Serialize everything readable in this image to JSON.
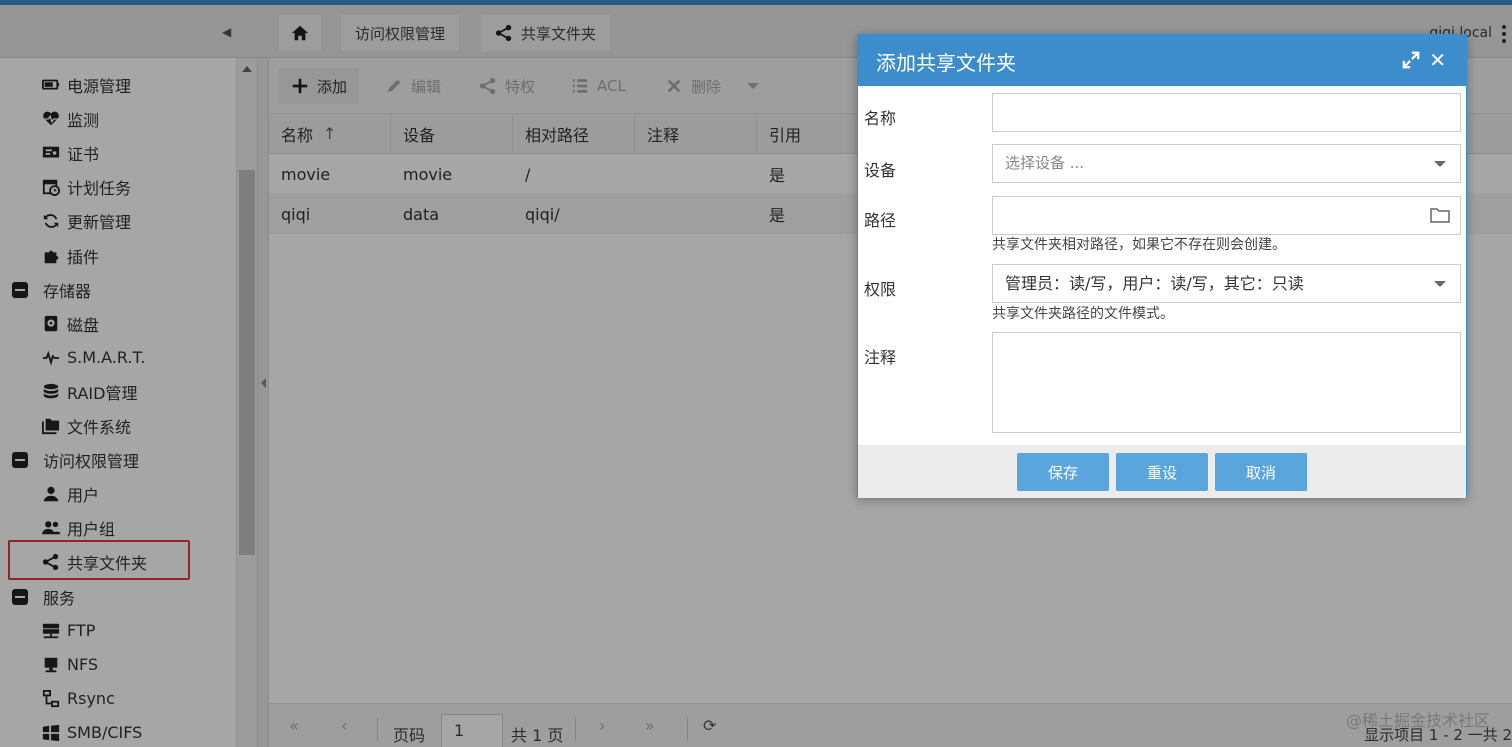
{
  "header": {
    "hostname": "qiqi.local",
    "breadcrumbs": [
      "访问权限管理",
      "共享文件夹"
    ]
  },
  "sidebar": {
    "items": [
      {
        "label": "电源管理",
        "icon": "power-icon"
      },
      {
        "label": "监测",
        "icon": "heartbeat-icon"
      },
      {
        "label": "证书",
        "icon": "certificate-icon"
      },
      {
        "label": "计划任务",
        "icon": "calendar-clock-icon"
      },
      {
        "label": "更新管理",
        "icon": "refresh-icon"
      },
      {
        "label": "插件",
        "icon": "puzzle-icon"
      },
      {
        "label": "存储器",
        "group": true
      },
      {
        "label": "磁盘",
        "icon": "disk-icon"
      },
      {
        "label": "S.M.A.R.T.",
        "icon": "pulse-icon"
      },
      {
        "label": "RAID管理",
        "icon": "database-icon"
      },
      {
        "label": "文件系统",
        "icon": "folders-icon"
      },
      {
        "label": "访问权限管理",
        "group": true
      },
      {
        "label": "用户",
        "icon": "user-icon"
      },
      {
        "label": "用户组",
        "icon": "users-icon"
      },
      {
        "label": "共享文件夹",
        "icon": "share-icon",
        "selected": true
      },
      {
        "label": "服务",
        "group": true
      },
      {
        "label": "FTP",
        "icon": "server-icon"
      },
      {
        "label": "NFS",
        "icon": "monitor-icon"
      },
      {
        "label": "Rsync",
        "icon": "sitemap-icon"
      },
      {
        "label": "SMB/CIFS",
        "icon": "windows-icon"
      }
    ]
  },
  "toolbar": {
    "add": "添加",
    "edit": "编辑",
    "privileges": "特权",
    "acl": "ACL",
    "delete": "删除"
  },
  "grid": {
    "columns": [
      "名称",
      "设备",
      "相对路径",
      "注释",
      "引用"
    ],
    "sort_indicator": "↑",
    "rows": [
      {
        "name": "movie",
        "device": "movie",
        "path": "/",
        "comment": "",
        "referenced": "是"
      },
      {
        "name": "qiqi",
        "device": "data",
        "path": "qiqi/",
        "comment": "",
        "referenced": "是"
      }
    ]
  },
  "pager": {
    "page_label": "页码",
    "page_value": "1",
    "total_label": "共 1 页",
    "info": "显示项目 1 - 2 一共 2"
  },
  "watermark": "@稀土掘金技术社区",
  "dialog": {
    "title": "添加共享文件夹",
    "name_label": "名称",
    "name_value": "",
    "device_label": "设备",
    "device_placeholder": "选择设备 ...",
    "path_label": "路径",
    "path_value": "",
    "path_help": "共享文件夹相对路径，如果它不存在则会创建。",
    "perm_label": "权限",
    "perm_value": "管理员：读/写，用户：读/写，其它：只读",
    "perm_help": "共享文件夹路径的文件模式。",
    "comment_label": "注释",
    "comment_value": "",
    "save": "保存",
    "reset": "重设",
    "cancel": "取消"
  },
  "colors": {
    "accent": "#3d8ccc",
    "button": "#5aa6dc",
    "highlight": "#e53935"
  }
}
